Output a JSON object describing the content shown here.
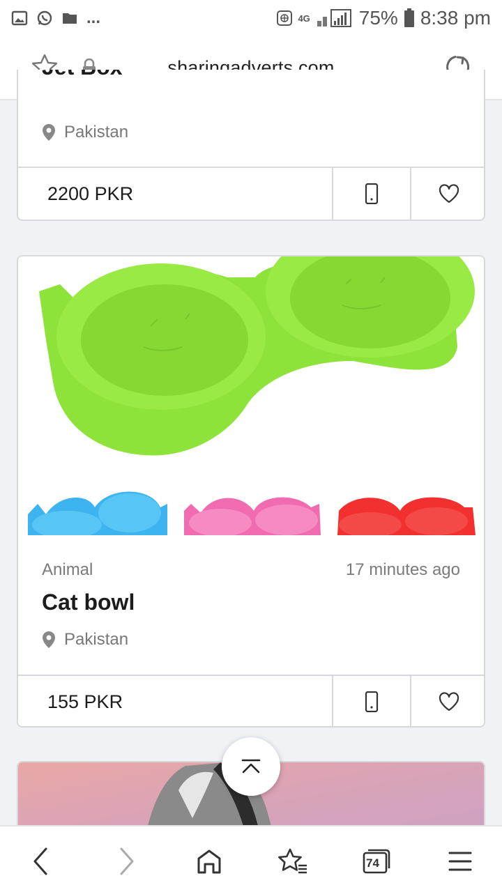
{
  "status_bar": {
    "left_icons": [
      "gallery-icon",
      "whatsapp-icon",
      "folder-icon"
    ],
    "overflow": "...",
    "network": "4G",
    "battery": "75%",
    "time": "8:38 pm"
  },
  "browser": {
    "url": "sharingadverts.com"
  },
  "listings": [
    {
      "title_partial": "Jet Box",
      "location": "Pakistan",
      "price": "2200 PKR"
    },
    {
      "category": "Animal",
      "posted": "17 minutes ago",
      "title": "Cat bowl",
      "location": "Pakistan",
      "price": "155 PKR"
    }
  ],
  "bottom_nav": {
    "tab_count": "74",
    "icons": [
      "back-icon",
      "forward-icon",
      "home-icon",
      "bookmarks-icon",
      "tabs-icon",
      "menu-icon"
    ]
  },
  "colors": {
    "bowl_green": "#8ee33a",
    "bowl_blue": "#3db4ef",
    "bowl_pink": "#f06bb0",
    "bowl_red": "#f2302f"
  }
}
